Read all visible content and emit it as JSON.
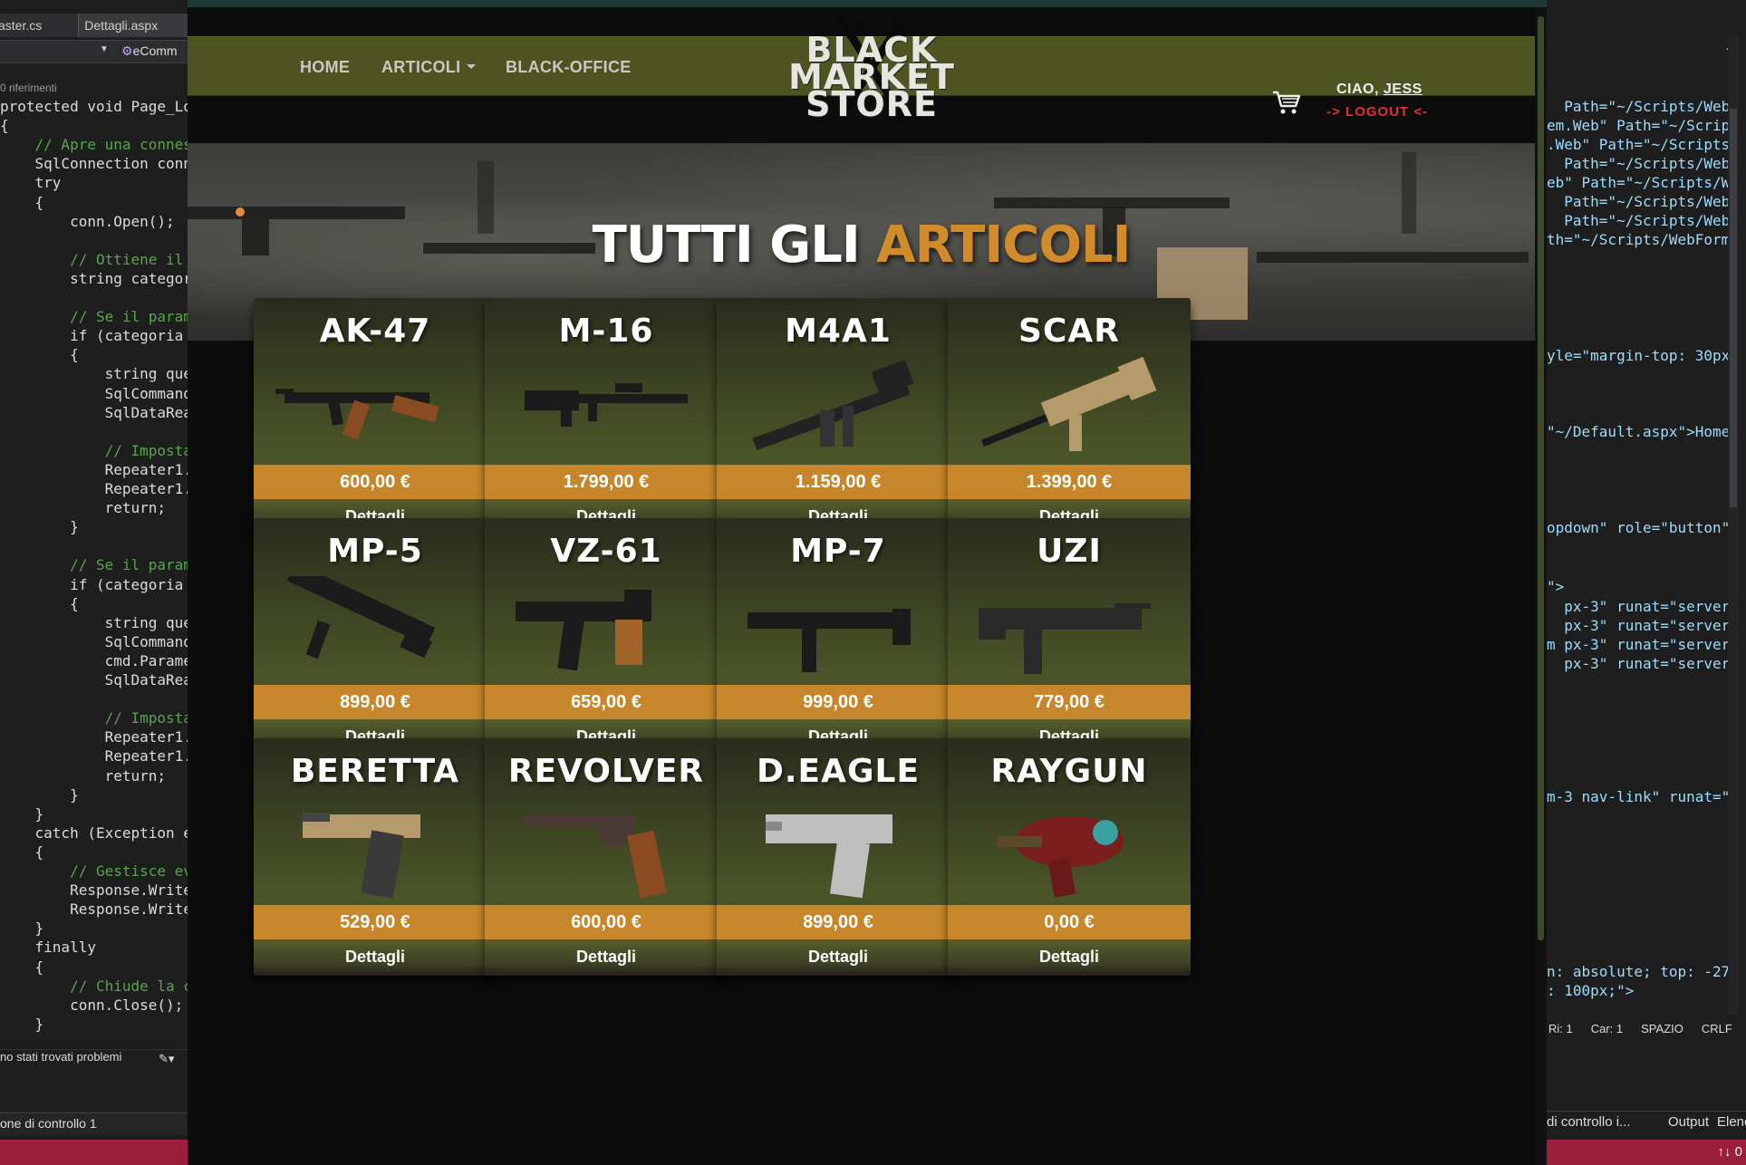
{
  "ide_left": {
    "tab1": "aster.cs",
    "tab2": "Dettagli.aspx",
    "nav_class": "eComm",
    "refs": "0 riferimenti",
    "code": [
      "protected void Page_Lo",
      "{",
      "    // Apre una connes",
      "    SqlConnection conn",
      "    try",
      "    {",
      "        conn.Open();",
      "",
      "        // Ottiene il",
      "        string categor",
      "",
      "        // Se il param",
      "        if (categoria",
      "        {",
      "            string que",
      "            SqlCommand",
      "            SqlDataRea",
      "",
      "            // Imposta",
      "            Repeater1.",
      "            Repeater1.",
      "            return;",
      "        }",
      "",
      "        // Se il param",
      "        if (categoria",
      "        {",
      "            string que",
      "            SqlCommand",
      "            cmd.Parame",
      "            SqlDataRea",
      "",
      "            // Imposta",
      "            Repeater1.",
      "            Repeater1.",
      "            return;",
      "        }",
      "    }",
      "    catch (Exception e",
      "    {",
      "        // Gestisce ev",
      "        Response.Write",
      "        Response.Write",
      "    }",
      "    finally",
      "    {",
      "        // Chiude la c",
      "        conn.Close();",
      "    }"
    ],
    "status": "no stati trovati problemi",
    "bottom": "one di controllo 1"
  },
  "ide_right": {
    "code": [
      "  Path=\"~/Scripts/WebF",
      "em.Web\" Path=\"~/Scrip",
      ".Web\" Path=\"~/Scripts",
      "  Path=\"~/Scripts/WebF",
      "eb\" Path=\"~/Scripts/W",
      "  Path=\"~/Scripts/WebF",
      "  Path=\"~/Scripts/WebF",
      "th=\"~/Scripts/WebForm",
      "yle=\"margin-top: 30px",
      "\"~/Default.aspx\">Home",
      "opdown\" role=\"button\"",
      "\">",
      "  px-3\" runat=\"server\"",
      "  px-3\" runat=\"server\"",
      "m px-3\" runat=\"server",
      "  px-3\" runat=\"server\"",
      "m-3 nav-link\" runat=\"",
      "n: absolute; top: -27",
      ": 100px;\">"
    ],
    "status": [
      "Ri: 1",
      "Car: 1",
      "SPAZIO",
      "CRLF"
    ],
    "bottom_tabs": [
      "di controllo i...",
      "Output",
      "Elenco"
    ],
    "redbar": "↑↓ 0"
  },
  "site": {
    "nav": {
      "home": "HOME",
      "articoli": "ARTICOLI",
      "black_office": "BLACK-OFFICE"
    },
    "logo": "BLACK MARKET STORE",
    "greeting_prefix": "CIAO, ",
    "user": "JESS",
    "logout": "-> LOGOUT <-",
    "hero_title_white": "TUTTI GLI",
    "hero_title_accent": "ARTICOLI",
    "details_label": "Dettagli",
    "products": [
      {
        "name": "AK-47",
        "price": "600,00 €",
        "icon": "ak47-image"
      },
      {
        "name": "M-16",
        "price": "1.799,00 €",
        "icon": "m16-image"
      },
      {
        "name": "M4A1",
        "price": "1.159,00 €",
        "icon": "m4a1-image"
      },
      {
        "name": "SCAR",
        "price": "1.399,00 €",
        "icon": "scar-image"
      },
      {
        "name": "MP-5",
        "price": "899,00 €",
        "icon": "mp5-image"
      },
      {
        "name": "VZ-61",
        "price": "659,00 €",
        "icon": "vz61-image"
      },
      {
        "name": "MP-7",
        "price": "999,00 €",
        "icon": "mp7-image"
      },
      {
        "name": "UZI",
        "price": "779,00 €",
        "icon": "uzi-image"
      },
      {
        "name": "BERETTA",
        "price": "529,00 €",
        "icon": "beretta-image"
      },
      {
        "name": "REVOLVER",
        "price": "600,00 €",
        "icon": "revolver-image"
      },
      {
        "name": "D.EAGLE",
        "price": "899,00 €",
        "icon": "deagle-image"
      },
      {
        "name": "RAYGUN",
        "price": "0,00 €",
        "icon": "raygun-image"
      }
    ]
  },
  "colors": {
    "navbar": "#4d5321",
    "accent": "#d18b2a",
    "price_bar": "#c8862a",
    "logout": "#e0303a",
    "ide_statusbar": "#9b1e3a"
  }
}
